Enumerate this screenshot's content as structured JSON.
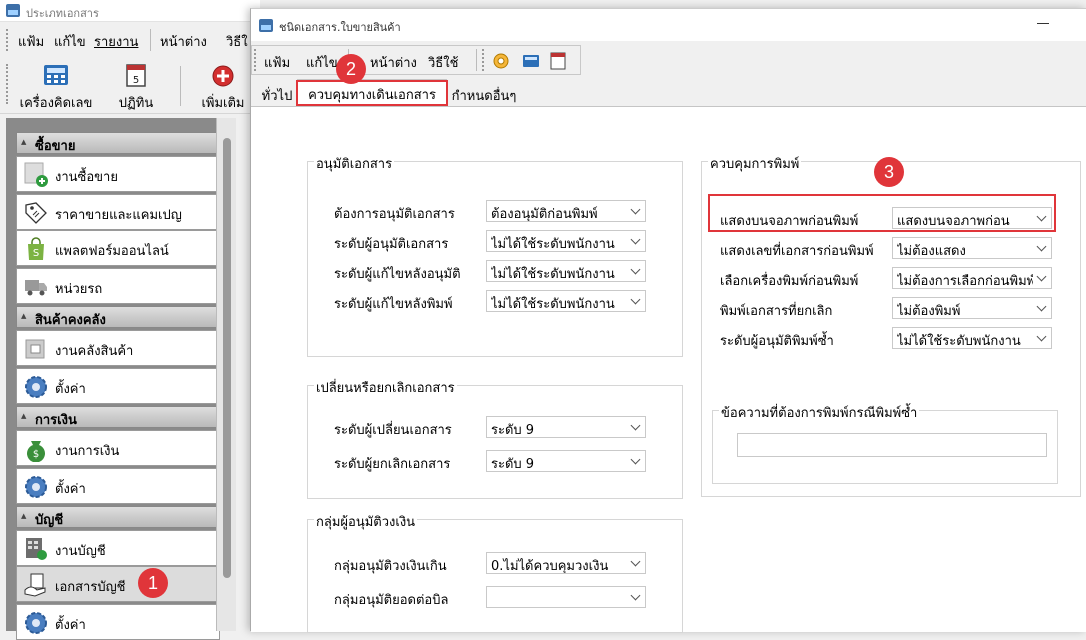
{
  "main_window": {
    "title": "ประเภทเอกสาร",
    "menu": [
      "แฟ้ม",
      "แก้ไข",
      "รายงาน",
      "หน้าต่าง",
      "วิธีใ"
    ],
    "toolbar": [
      {
        "label": "เครื่องคิดเลข",
        "icon": "calculator-icon"
      },
      {
        "label": "ปฏิทิน",
        "icon": "calendar-icon"
      },
      {
        "label": "เพิ่มเติม",
        "icon": "add-circle-icon"
      }
    ]
  },
  "sidebar": {
    "groups": [
      {
        "title": "ซื้อขาย",
        "items": [
          {
            "label": "งานซื้อขาย",
            "icon": "sales-doc-icon"
          },
          {
            "label": "ราคาขายและแคมเปญ",
            "icon": "price-tag-icon"
          },
          {
            "label": "แพลตฟอร์มออนไลน์",
            "icon": "shopping-bag-icon"
          },
          {
            "label": "หน่วยรถ",
            "icon": "truck-icon"
          }
        ]
      },
      {
        "title": "สินค้าคงคลัง",
        "items": [
          {
            "label": "งานคลังสินค้า",
            "icon": "warehouse-icon"
          },
          {
            "label": "ตั้งค่า",
            "icon": "gear-icon"
          }
        ]
      },
      {
        "title": "การเงิน",
        "items": [
          {
            "label": "งานการเงิน",
            "icon": "money-bag-icon"
          },
          {
            "label": "ตั้งค่า",
            "icon": "gear-icon"
          }
        ]
      },
      {
        "title": "บัญชี",
        "items": [
          {
            "label": "งานบัญชี",
            "icon": "ledger-icon"
          },
          {
            "label": "เอกสารบัญชี",
            "icon": "hand-document-icon",
            "selected": true
          },
          {
            "label": "ตั้งค่า",
            "icon": "gear-icon"
          }
        ]
      }
    ]
  },
  "dialog": {
    "title": "ชนิดเอกสาร.ใบขายสินค้า",
    "menu": [
      "แฟ้ม",
      "แก้ไข",
      "หน้าต่าง",
      "วิธีใช้"
    ],
    "tabs": [
      "ทั่วไป",
      "ควบคุมทางเดินเอกสาร",
      "กำหนดอื่นๆ"
    ],
    "active_tab": "ควบคุมทางเดินเอกสาร",
    "approve_group": {
      "title": "อนุมัติเอกสาร",
      "fields": [
        {
          "label": "ต้องการอนุมัติเอกสาร",
          "value": "ต้องอนุมัติก่อนพิมพ์"
        },
        {
          "label": "ระดับผู้อนุมัติเอกสาร",
          "value": "ไม่ได้ใช้ระดับพนักงาน"
        },
        {
          "label": "ระดับผู้แก้ไขหลังอนุมัติ",
          "value": "ไม่ได้ใช้ระดับพนักงาน"
        },
        {
          "label": "ระดับผู้แก้ไขหลังพิมพ์",
          "value": "ไม่ได้ใช้ระดับพนักงาน"
        }
      ]
    },
    "change_group": {
      "title": "เปลี่ยนหรือยกเลิกเอกสาร",
      "fields": [
        {
          "label": "ระดับผู้เปลี่ยนเอกสาร",
          "value": "ระดับ 9"
        },
        {
          "label": "ระดับผู้ยกเลิกเอกสาร",
          "value": "ระดับ 9"
        }
      ]
    },
    "credit_group": {
      "title": "กลุ่มผู้อนุมัติวงเงิน",
      "fields": [
        {
          "label": "กลุ่มอนุมัติวงเงินเกิน",
          "value": "0.ไม่ได้ควบคุมวงเงิน"
        },
        {
          "label": "กลุ่มอนุมัติยอดต่อบิล",
          "value": ""
        }
      ]
    },
    "print_group": {
      "title": "ควบคุมการพิมพ์",
      "fields": [
        {
          "label": "แสดงบนจอภาพก่อนพิมพ์",
          "value": "แสดงบนจอภาพก่อน"
        },
        {
          "label": "แสดงเลขที่เอกสารก่อนพิมพ์",
          "value": "ไม่ต้องแสดง"
        },
        {
          "label": "เลือกเครื่องพิมพ์ก่อนพิมพ์",
          "value": "ไม่ต้องการเลือกก่อนพิมพ์"
        },
        {
          "label": "พิมพ์เอกสารที่ยกเลิก",
          "value": "ไม่ต้องพิมพ์"
        },
        {
          "label": "ระดับผู้อนุมัติพิมพ์ซ้ำ",
          "value": "ไม่ได้ใช้ระดับพนักงาน"
        }
      ],
      "reprint_message": {
        "title": "ข้อความที่ต้องการพิมพ์กรณีพิมพ์ซ้ำ",
        "value": ""
      }
    }
  },
  "annotations": [
    "1",
    "2",
    "3"
  ],
  "colors": {
    "highlight": "#e0353a"
  }
}
